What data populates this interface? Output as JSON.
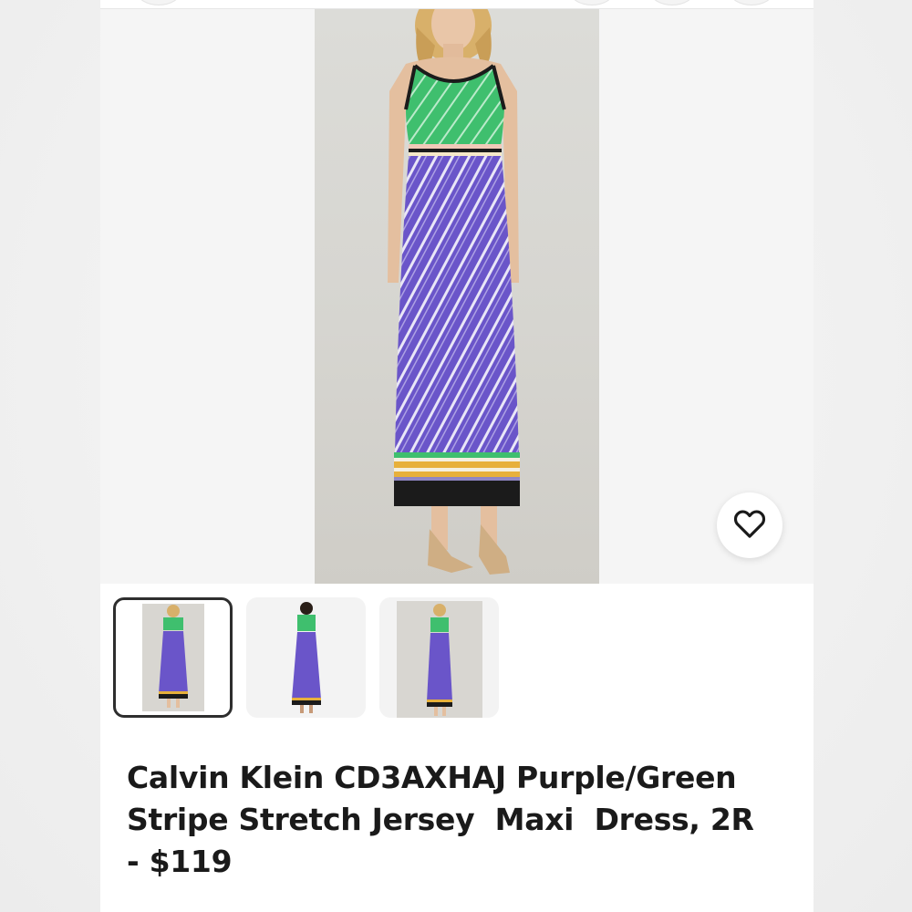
{
  "listing": {
    "title_lines": [
      "Calvin Klein CD3AXHAJ Purple/Green",
      "Stripe Stretch Jersey  Maxi  Dress, 2R",
      "- $119"
    ]
  },
  "gallery": {
    "thumbnail_count": 3,
    "selected_index": 0
  },
  "actions": {
    "favorite_icon": "heart-icon"
  },
  "colors": {
    "dress_green": "#3fbf6e",
    "dress_purple": "#6a55c9",
    "hem_yellow": "#e7b03b",
    "hem_black": "#1b1b1b",
    "selected_border": "#2e2e2e"
  }
}
